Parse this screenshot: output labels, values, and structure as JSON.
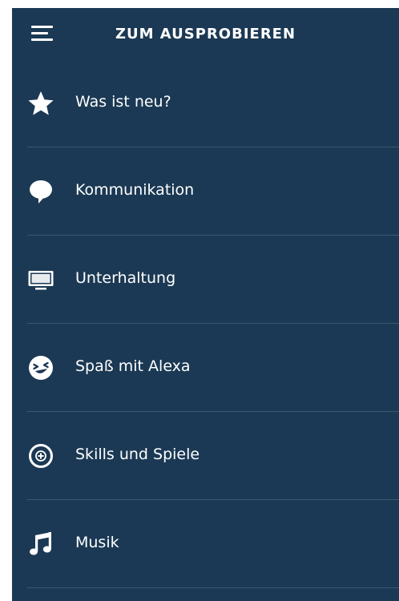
{
  "header": {
    "title": "ZUM AUSPROBIEREN",
    "menu_icon": "hamburger-menu-icon"
  },
  "menu": {
    "items": [
      {
        "label": "Was ist neu?",
        "icon": "star-icon"
      },
      {
        "label": "Kommunikation",
        "icon": "speech-bubble-icon"
      },
      {
        "label": "Unterhaltung",
        "icon": "tv-icon"
      },
      {
        "label": "Spaß mit Alexa",
        "icon": "laughing-face-icon"
      },
      {
        "label": "Skills und Spiele",
        "icon": "plus-circle-icon"
      },
      {
        "label": "Musik",
        "icon": "music-note-icon"
      }
    ]
  },
  "colors": {
    "background": "#1b3954",
    "divider": "#3b5873",
    "text": "#ffffff"
  }
}
